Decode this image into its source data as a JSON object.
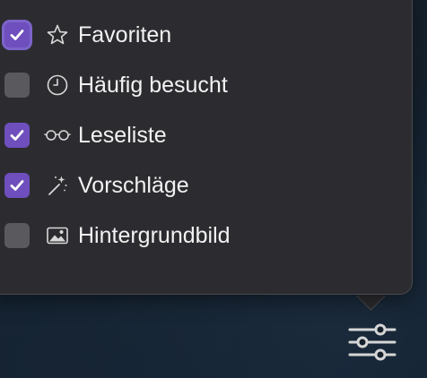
{
  "menu": {
    "items": [
      {
        "label": "Favoriten",
        "checked": true,
        "icon": "star-icon"
      },
      {
        "label": "Häufig besucht",
        "checked": false,
        "icon": "clock-icon"
      },
      {
        "label": "Leseliste",
        "checked": true,
        "icon": "glasses-icon"
      },
      {
        "label": "Vorschläge",
        "checked": true,
        "icon": "magic-wand-icon"
      },
      {
        "label": "Hintergrundbild",
        "checked": false,
        "icon": "image-icon"
      }
    ]
  },
  "colors": {
    "checkbox_checked": "#6e4fbd",
    "checkbox_unchecked": "#5a5a5e",
    "popover_bg": "#2c2c30",
    "text": "#f2f2f2"
  },
  "footer": {
    "settings_icon": "sliders-icon"
  }
}
